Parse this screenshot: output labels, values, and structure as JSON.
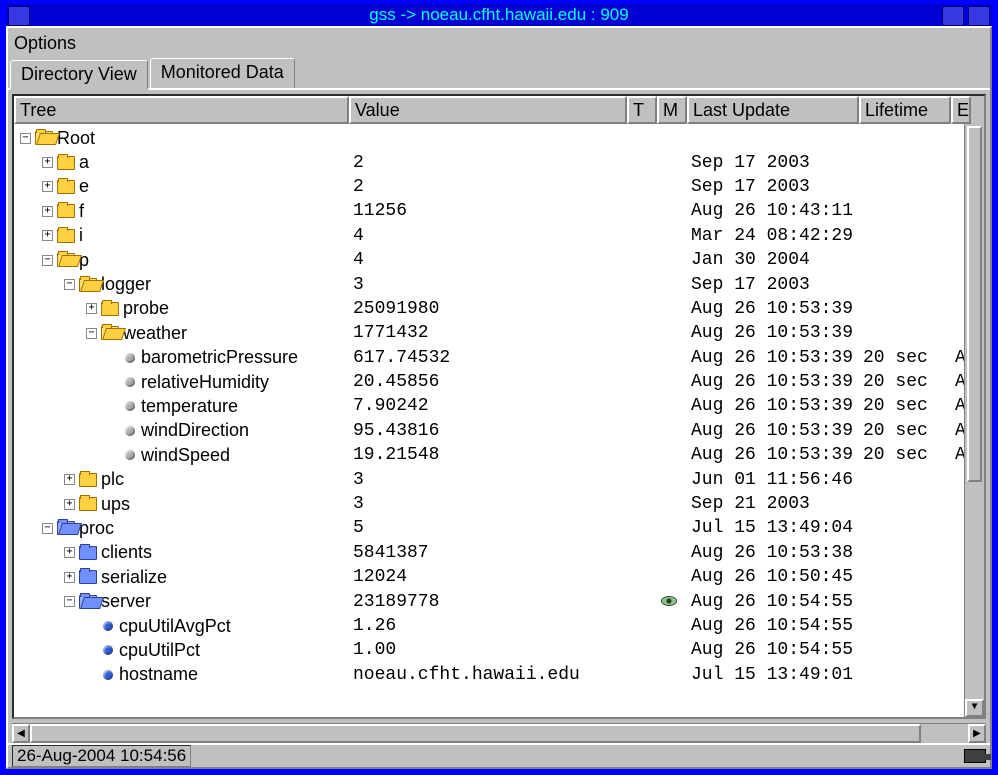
{
  "window": {
    "title": "gss -> noeau.cfht.hawaii.edu : 909"
  },
  "menubar": {
    "options": "Options"
  },
  "tabs": {
    "directory_view": "Directory View",
    "monitored_data": "Monitored Data"
  },
  "columns": {
    "tree": "Tree",
    "value": "Value",
    "t": "T",
    "m": "M",
    "update": "Last Update",
    "lifetime": "Lifetime",
    "e": "E"
  },
  "statusbar": {
    "time": "26-Aug-2004 10:54:56"
  },
  "rows": [
    {
      "indent": 0,
      "toggle": "-",
      "icon": "folder-open",
      "name": "Root",
      "value": "",
      "update": "",
      "lifetime": "",
      "m": "",
      "e": ""
    },
    {
      "indent": 1,
      "toggle": "+",
      "icon": "folder",
      "name": "a",
      "value": "2",
      "update": "Sep 17 2003",
      "lifetime": "",
      "m": "",
      "e": ""
    },
    {
      "indent": 1,
      "toggle": "+",
      "icon": "folder",
      "name": "e",
      "value": "2",
      "update": "Sep 17 2003",
      "lifetime": "",
      "m": "",
      "e": ""
    },
    {
      "indent": 1,
      "toggle": "+",
      "icon": "folder",
      "name": "f",
      "value": "11256",
      "update": "Aug 26 10:43:11",
      "lifetime": "",
      "m": "",
      "e": ""
    },
    {
      "indent": 1,
      "toggle": "+",
      "icon": "folder",
      "name": "i",
      "value": "4",
      "update": "Mar 24 08:42:29",
      "lifetime": "",
      "m": "",
      "e": ""
    },
    {
      "indent": 1,
      "toggle": "-",
      "icon": "folder-open",
      "name": "p",
      "value": "4",
      "update": "Jan 30 2004",
      "lifetime": "",
      "m": "",
      "e": ""
    },
    {
      "indent": 2,
      "toggle": "-",
      "icon": "folder-open",
      "name": "logger",
      "value": "3",
      "update": "Sep 17 2003",
      "lifetime": "",
      "m": "",
      "e": ""
    },
    {
      "indent": 3,
      "toggle": "+",
      "icon": "folder",
      "name": "probe",
      "value": "25091980",
      "update": "Aug 26 10:53:39",
      "lifetime": "",
      "m": "",
      "e": ""
    },
    {
      "indent": 3,
      "toggle": "-",
      "icon": "folder-open",
      "name": "weather",
      "value": "1771432",
      "update": "Aug 26 10:53:39",
      "lifetime": "",
      "m": "",
      "e": ""
    },
    {
      "indent": 4,
      "toggle": "",
      "icon": "bullet-grey",
      "name": "barometricPressure",
      "value": "617.74532",
      "update": "Aug 26 10:53:39",
      "lifetime": "20 sec",
      "m": "",
      "e": "A"
    },
    {
      "indent": 4,
      "toggle": "",
      "icon": "bullet-grey",
      "name": "relativeHumidity",
      "value": "20.45856",
      "update": "Aug 26 10:53:39",
      "lifetime": "20 sec",
      "m": "",
      "e": "A"
    },
    {
      "indent": 4,
      "toggle": "",
      "icon": "bullet-grey",
      "name": "temperature",
      "value": "7.90242",
      "update": "Aug 26 10:53:39",
      "lifetime": "20 sec",
      "m": "",
      "e": "A"
    },
    {
      "indent": 4,
      "toggle": "",
      "icon": "bullet-grey",
      "name": "windDirection",
      "value": "95.43816",
      "update": "Aug 26 10:53:39",
      "lifetime": "20 sec",
      "m": "",
      "e": "A"
    },
    {
      "indent": 4,
      "toggle": "",
      "icon": "bullet-grey",
      "name": "windSpeed",
      "value": "19.21548",
      "update": "Aug 26 10:53:39",
      "lifetime": "20 sec",
      "m": "",
      "e": "A"
    },
    {
      "indent": 2,
      "toggle": "+",
      "icon": "folder",
      "name": "plc",
      "value": "3",
      "update": "Jun 01 11:56:46",
      "lifetime": "",
      "m": "",
      "e": ""
    },
    {
      "indent": 2,
      "toggle": "+",
      "icon": "folder",
      "name": "ups",
      "value": "3",
      "update": "Sep 21 2003",
      "lifetime": "",
      "m": "",
      "e": ""
    },
    {
      "indent": 1,
      "toggle": "-",
      "icon": "folder-blue-open",
      "name": "proc",
      "value": "5",
      "update": "Jul 15 13:49:04",
      "lifetime": "",
      "m": "",
      "e": ""
    },
    {
      "indent": 2,
      "toggle": "+",
      "icon": "folder-blue",
      "name": "clients",
      "value": "5841387",
      "update": "Aug 26 10:53:38",
      "lifetime": "",
      "m": "",
      "e": ""
    },
    {
      "indent": 2,
      "toggle": "+",
      "icon": "folder-blue",
      "name": "serialize",
      "value": "12024",
      "update": "Aug 26 10:50:45",
      "lifetime": "",
      "m": "",
      "e": ""
    },
    {
      "indent": 2,
      "toggle": "-",
      "icon": "folder-blue-open",
      "name": "server",
      "value": "23189778",
      "update": "Aug 26 10:54:55",
      "lifetime": "",
      "m": "eye",
      "e": ""
    },
    {
      "indent": 3,
      "toggle": "",
      "icon": "bullet-blue",
      "name": "cpuUtilAvgPct",
      "value": "1.26",
      "update": "Aug 26 10:54:55",
      "lifetime": "",
      "m": "",
      "e": ""
    },
    {
      "indent": 3,
      "toggle": "",
      "icon": "bullet-blue",
      "name": "cpuUtilPct",
      "value": "1.00",
      "update": "Aug 26 10:54:55",
      "lifetime": "",
      "m": "",
      "e": ""
    },
    {
      "indent": 3,
      "toggle": "",
      "icon": "bullet-blue",
      "name": "hostname",
      "value": "noeau.cfht.hawaii.edu",
      "update": "Jul 15 13:49:01",
      "lifetime": "",
      "m": "",
      "e": ""
    }
  ]
}
